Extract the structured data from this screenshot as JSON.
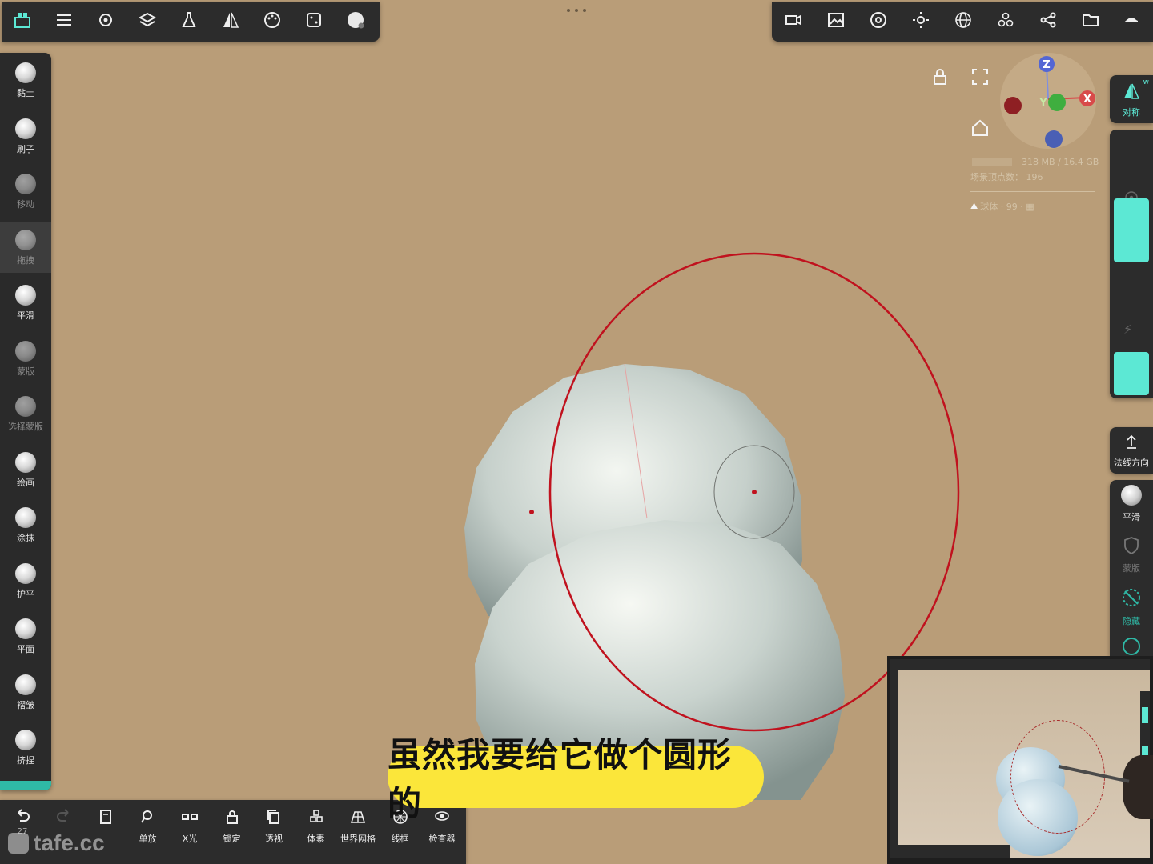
{
  "top_toolbar_left": [
    {
      "icon": "scene-icon"
    },
    {
      "icon": "sliders-icon"
    },
    {
      "icon": "gear-icon"
    },
    {
      "icon": "layers-icon"
    },
    {
      "icon": "flask-icon"
    },
    {
      "icon": "symmetry-icon"
    },
    {
      "icon": "palette-icon"
    },
    {
      "icon": "dice-icon"
    },
    {
      "icon": "material-sphere-icon"
    }
  ],
  "top_toolbar_right": [
    {
      "icon": "video-icon"
    },
    {
      "icon": "image-icon"
    },
    {
      "icon": "aperture-icon"
    },
    {
      "icon": "sun-icon"
    },
    {
      "icon": "grid-sphere-icon"
    },
    {
      "icon": "spheres-icon"
    },
    {
      "icon": "share-icon"
    },
    {
      "icon": "folder-icon"
    },
    {
      "icon": "hat-icon"
    }
  ],
  "tools": [
    {
      "label": "黏土",
      "dim": false,
      "selected": false
    },
    {
      "label": "刷子",
      "dim": false,
      "selected": false
    },
    {
      "label": "移动",
      "dim": true,
      "selected": false
    },
    {
      "label": "拖拽",
      "dim": true,
      "selected": true
    },
    {
      "label": "平滑",
      "dim": false,
      "selected": false
    },
    {
      "label": "蒙版",
      "dim": true,
      "selected": false
    },
    {
      "label": "选择蒙版",
      "dim": true,
      "selected": false
    },
    {
      "label": "绘画",
      "dim": false,
      "selected": false
    },
    {
      "label": "涂抹",
      "dim": false,
      "selected": false
    },
    {
      "label": "护平",
      "dim": false,
      "selected": false
    },
    {
      "label": "平面",
      "dim": false,
      "selected": false
    },
    {
      "label": "褶皱",
      "dim": false,
      "selected": false
    },
    {
      "label": "挤捏",
      "dim": false,
      "selected": false
    }
  ],
  "gizmo": {
    "z": "Z",
    "y": "Y",
    "x": "X",
    "red": "#c8353f",
    "green": "#3fae3f",
    "blue": "#4a5fb5"
  },
  "stats": {
    "memory": "318 MB / 16.4 GB",
    "vertices": "场景顶点数： 196",
    "object": "球体 · 99 · ▦"
  },
  "right_panel": {
    "symmetry_label": "对称",
    "symmetry_mark": "w",
    "normal_label": "法线方向",
    "smooth_label": "平滑",
    "mask_label": "蒙版",
    "hide_label": "隐藏"
  },
  "bottom_toolbar": {
    "undo_count": "27",
    "buttons": [
      {
        "icon": "book-icon",
        "label": ""
      },
      {
        "icon": "search-icon",
        "label": "单放"
      },
      {
        "icon": "glasses-icon",
        "label": "X光"
      },
      {
        "icon": "lock-icon",
        "label": "锁定"
      },
      {
        "icon": "copy-icon",
        "label": "透视"
      },
      {
        "icon": "voxel-icon",
        "label": "体素"
      },
      {
        "icon": "world-grid-icon",
        "label": "世界网格"
      },
      {
        "icon": "wireframe-icon",
        "label": "线框"
      },
      {
        "icon": "inspector-icon",
        "label": "检查器"
      }
    ]
  },
  "caption": "虽然我要给它做个圆形的",
  "watermark": "tafe.cc",
  "colors": {
    "background": "#b99d78",
    "accent": "#5ce8d4",
    "brush_ring": "#c0121e",
    "caption_bg": "#fbe63a"
  }
}
